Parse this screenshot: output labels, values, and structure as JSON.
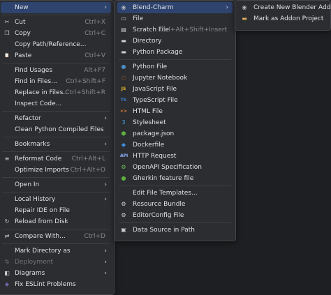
{
  "main_menu": [
    {
      "type": "item",
      "label": "New",
      "submenu": true,
      "selected": true
    },
    {
      "type": "sep"
    },
    {
      "type": "item",
      "label": "Cut",
      "shortcut": "Ctrl+X",
      "icon": "cut-icon"
    },
    {
      "type": "item",
      "label": "Copy",
      "shortcut": "Ctrl+C",
      "icon": "copy-icon"
    },
    {
      "type": "item",
      "label": "Copy Path/Reference..."
    },
    {
      "type": "item",
      "label": "Paste",
      "shortcut": "Ctrl+V",
      "icon": "paste-icon"
    },
    {
      "type": "sep"
    },
    {
      "type": "item",
      "label": "Find Usages",
      "shortcut": "Alt+F7"
    },
    {
      "type": "item",
      "label": "Find in Files...",
      "shortcut": "Ctrl+Shift+F"
    },
    {
      "type": "item",
      "label": "Replace in Files...",
      "shortcut": "Ctrl+Shift+R"
    },
    {
      "type": "item",
      "label": "Inspect Code..."
    },
    {
      "type": "sep"
    },
    {
      "type": "item",
      "label": "Refactor",
      "submenu": true
    },
    {
      "type": "item",
      "label": "Clean Python Compiled Files"
    },
    {
      "type": "sep"
    },
    {
      "type": "item",
      "label": "Bookmarks",
      "submenu": true
    },
    {
      "type": "sep"
    },
    {
      "type": "item",
      "label": "Reformat Code",
      "shortcut": "Ctrl+Alt+L",
      "icon": "reformat-icon"
    },
    {
      "type": "item",
      "label": "Optimize Imports",
      "shortcut": "Ctrl+Alt+O"
    },
    {
      "type": "sep"
    },
    {
      "type": "item",
      "label": "Open In",
      "submenu": true
    },
    {
      "type": "sep"
    },
    {
      "type": "item",
      "label": "Local History",
      "submenu": true
    },
    {
      "type": "item",
      "label": "Repair IDE on File"
    },
    {
      "type": "item",
      "label": "Reload from Disk",
      "icon": "reload-icon"
    },
    {
      "type": "sep"
    },
    {
      "type": "item",
      "label": "Compare With...",
      "shortcut": "Ctrl+D",
      "icon": "compare-icon"
    },
    {
      "type": "sep"
    },
    {
      "type": "item",
      "label": "Mark Directory as",
      "submenu": true
    },
    {
      "type": "item",
      "label": "Deployment",
      "submenu": true,
      "disabled": true,
      "icon": "deployment-icon"
    },
    {
      "type": "item",
      "label": "Diagrams",
      "submenu": true,
      "icon": "diagrams-icon"
    },
    {
      "type": "item",
      "label": "Fix ESLint Problems",
      "icon": "eslint-icon"
    }
  ],
  "new_menu": [
    {
      "type": "item",
      "label": "Blend-Charm",
      "submenu": true,
      "selected": true,
      "icon": "blender-icon"
    },
    {
      "type": "item",
      "label": "File",
      "icon": "file-icon"
    },
    {
      "type": "item",
      "label": "Scratch File",
      "shortcut": "Ctrl+Alt+Shift+Insert",
      "icon": "scratch-file-icon"
    },
    {
      "type": "item",
      "label": "Directory",
      "icon": "folder-icon"
    },
    {
      "type": "item",
      "label": "Python Package",
      "icon": "python-package-icon"
    },
    {
      "type": "sep"
    },
    {
      "type": "item",
      "label": "Python File",
      "icon": "python-file-icon"
    },
    {
      "type": "item",
      "label": "Jupyter Notebook",
      "icon": "jupyter-icon"
    },
    {
      "type": "item",
      "label": "JavaScript File",
      "icon": "javascript-icon"
    },
    {
      "type": "item",
      "label": "TypeScript File",
      "icon": "typescript-icon"
    },
    {
      "type": "item",
      "label": "HTML File",
      "icon": "html-icon"
    },
    {
      "type": "item",
      "label": "Stylesheet",
      "icon": "css-icon"
    },
    {
      "type": "item",
      "label": "package.json",
      "icon": "nodejs-icon"
    },
    {
      "type": "item",
      "label": "Dockerfile",
      "icon": "docker-icon"
    },
    {
      "type": "item",
      "label": "HTTP Request",
      "icon": "http-request-icon"
    },
    {
      "type": "item",
      "label": "OpenAPI Specification",
      "icon": "openapi-icon"
    },
    {
      "type": "item",
      "label": "Gherkin feature file",
      "icon": "gherkin-icon"
    },
    {
      "type": "sep"
    },
    {
      "type": "item",
      "label": "Edit File Templates..."
    },
    {
      "type": "item",
      "label": "Resource Bundle",
      "icon": "resource-bundle-icon"
    },
    {
      "type": "item",
      "label": "EditorConfig File",
      "icon": "editorconfig-icon"
    },
    {
      "type": "sep"
    },
    {
      "type": "item",
      "label": "Data Source in Path",
      "icon": "database-icon"
    }
  ],
  "blend_menu": [
    {
      "type": "item",
      "label": "Create New Blender Addon",
      "icon": "blender-addon-icon"
    },
    {
      "type": "item",
      "label": "Mark as Addon Project",
      "icon": "addon-folder-icon"
    }
  ],
  "icon_glyphs": {
    "cut-icon": "✂",
    "copy-icon": "❐",
    "paste-icon": "📋",
    "reformat-icon": "≡",
    "reload-icon": "↻",
    "compare-icon": "⇄",
    "deployment-icon": "⇅",
    "diagrams-icon": "◧",
    "eslint-icon": "◈",
    "blender-icon": "◉",
    "file-icon": "▭",
    "scratch-file-icon": "▤",
    "folder-icon": "▬",
    "python-package-icon": "▬",
    "python-file-icon": "●",
    "jupyter-icon": "◌",
    "javascript-icon": "JS",
    "typescript-icon": "TS",
    "html-icon": "<>",
    "css-icon": "3",
    "nodejs-icon": "⬢",
    "docker-icon": "◆",
    "http-request-icon": "API",
    "openapi-icon": "⚙",
    "gherkin-icon": "●",
    "resource-bundle-icon": "⚙",
    "editorconfig-icon": "⚙",
    "database-icon": "▣",
    "blender-addon-icon": "◉",
    "addon-folder-icon": "▬"
  },
  "icon_colors": {
    "cut-icon": "#ced0d6",
    "copy-icon": "#ced0d6",
    "paste-icon": "#ced0d6",
    "reformat-icon": "#ced0d6",
    "reload-icon": "#ced0d6",
    "compare-icon": "#ced0d6",
    "deployment-icon": "#6f737a",
    "diagrams-icon": "#ced0d6",
    "eslint-icon": "#8a7bd6",
    "blender-icon": "#b0b3b8",
    "file-icon": "#ced0d6",
    "scratch-file-icon": "#ced0d6",
    "folder-icon": "#ced0d6",
    "python-package-icon": "#ced0d6",
    "python-file-icon": "#4b8bbe",
    "jupyter-icon": "#f37726",
    "javascript-icon": "#f0c02d",
    "typescript-icon": "#3d7fd9",
    "html-icon": "#e8813b",
    "css-icon": "#3ea0e6",
    "nodejs-icon": "#5fb13f",
    "docker-icon": "#3d8fe0",
    "http-request-icon": "#8fb4ff",
    "openapi-icon": "#6cbf55",
    "gherkin-icon": "#5fb13f",
    "resource-bundle-icon": "#ced0d6",
    "editorconfig-icon": "#ced0d6",
    "database-icon": "#ced0d6",
    "blender-addon-icon": "#b0b3b8",
    "addon-folder-icon": "#d9a75a"
  },
  "arrow_glyph": "›"
}
